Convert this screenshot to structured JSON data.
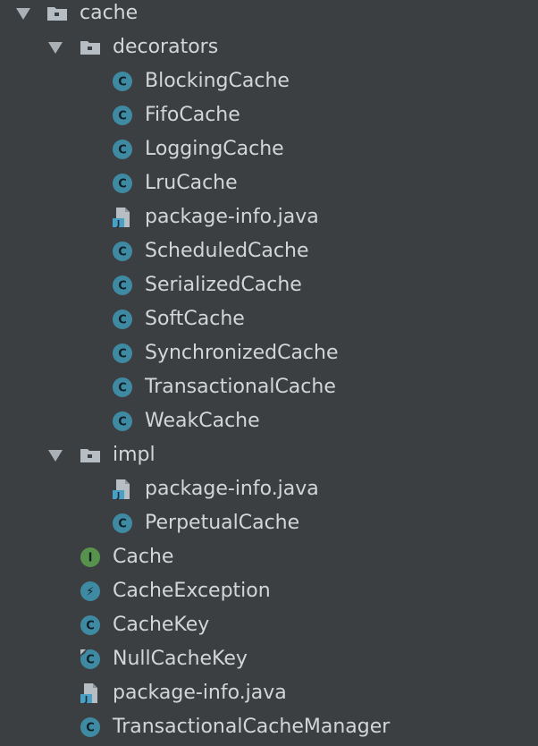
{
  "tree": [
    {
      "label": "cache",
      "type": "folder",
      "expanded": true,
      "level": 0
    },
    {
      "label": "decorators",
      "type": "folder",
      "expanded": true,
      "level": 1
    },
    {
      "label": "BlockingCache",
      "type": "class",
      "level": 2
    },
    {
      "label": "FifoCache",
      "type": "class",
      "level": 2
    },
    {
      "label": "LoggingCache",
      "type": "class",
      "level": 2
    },
    {
      "label": "LruCache",
      "type": "class",
      "level": 2
    },
    {
      "label": "package-info.java",
      "type": "java-file",
      "level": 2
    },
    {
      "label": "ScheduledCache",
      "type": "class",
      "level": 2
    },
    {
      "label": "SerializedCache",
      "type": "class",
      "level": 2
    },
    {
      "label": "SoftCache",
      "type": "class",
      "level": 2
    },
    {
      "label": "SynchronizedCache",
      "type": "class",
      "level": 2
    },
    {
      "label": "TransactionalCache",
      "type": "class",
      "level": 2
    },
    {
      "label": "WeakCache",
      "type": "class",
      "level": 2
    },
    {
      "label": "impl",
      "type": "folder",
      "expanded": true,
      "level": 1
    },
    {
      "label": "package-info.java",
      "type": "java-file",
      "level": 2
    },
    {
      "label": "PerpetualCache",
      "type": "class",
      "level": 2
    },
    {
      "label": "Cache",
      "type": "interface",
      "level": 1
    },
    {
      "label": "CacheException",
      "type": "exception",
      "level": 1
    },
    {
      "label": "CacheKey",
      "type": "class",
      "level": 1
    },
    {
      "label": "NullCacheKey",
      "type": "final-class",
      "level": 1
    },
    {
      "label": "package-info.java",
      "type": "java-file",
      "level": 1
    },
    {
      "label": "TransactionalCacheManager",
      "type": "class",
      "level": 1
    }
  ],
  "icons": {
    "class": {
      "name": "class-icon",
      "glyph": "C",
      "color": "#3f8aa3"
    },
    "interface": {
      "name": "interface-icon",
      "glyph": "I",
      "color": "#57934d"
    },
    "exception": {
      "name": "exception-icon",
      "glyph": "⚡",
      "color": "#3f8aa3"
    },
    "final-class": {
      "name": "class-final-icon",
      "glyph": "C",
      "color": "#3f8aa3"
    },
    "java-file": {
      "name": "java-file-icon",
      "glyph": "J",
      "color": "#4a9fc5"
    },
    "folder": {
      "name": "package-folder-icon",
      "glyph": "",
      "color": "#b7bec3"
    }
  }
}
